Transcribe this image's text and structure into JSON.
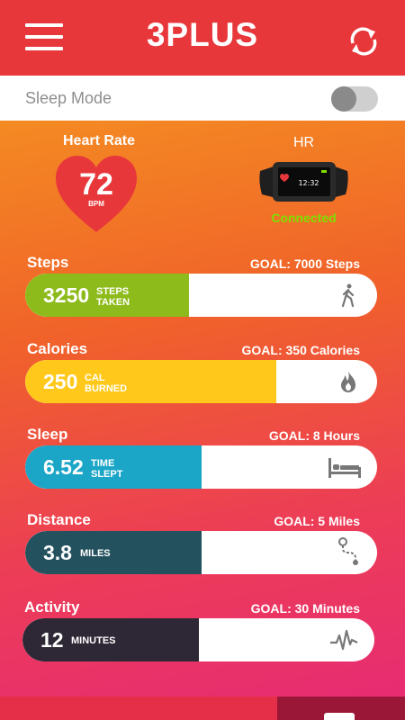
{
  "app": {
    "title": "3PLUS"
  },
  "header": {
    "menu_icon": "hamburger-menu-icon",
    "sync_icon": "sync-icon"
  },
  "sleep_mode": {
    "label": "Sleep Mode",
    "enabled": false
  },
  "heart_rate": {
    "title": "Heart Rate",
    "value": "72",
    "unit": "BPM",
    "color": "#e8373b"
  },
  "device": {
    "title": "HR",
    "status": "Connected",
    "status_color": "#7ee000",
    "screen_time": "12:32"
  },
  "metrics": {
    "steps": {
      "label": "Steps",
      "goal": "GOAL: 7000 Steps",
      "value": "3250",
      "unit1": "STEPS",
      "unit2": "TAKEN",
      "color": "#8dbb1b",
      "progress": 0.4643,
      "icon": "walking-person-icon"
    },
    "calories": {
      "label": "Calories",
      "goal": "GOAL: 350 Calories",
      "value": "250",
      "unit1": "CAL",
      "unit2": "BURNED",
      "color": "#ffc81a",
      "progress": 0.7143,
      "icon": "flame-icon"
    },
    "sleep": {
      "label": "Sleep",
      "goal": "GOAL: 8 Hours",
      "value": "6.52",
      "unit1": "TIME",
      "unit2": "SLEPT",
      "color": "#1ba5c7",
      "progress": 0.5,
      "icon": "bed-icon"
    },
    "distance": {
      "label": "Distance",
      "goal": "GOAL: 5 Miles",
      "value": "3.8",
      "unit1": "MILES",
      "color": "#24515e",
      "progress": 0.5,
      "icon": "route-icon"
    },
    "activity": {
      "label": "Activity",
      "goal": "GOAL: 30 Minutes",
      "value": "12",
      "unit1": "MINUTES",
      "color": "#2e2735",
      "progress": 0.5,
      "icon": "heartbeat-icon"
    }
  }
}
